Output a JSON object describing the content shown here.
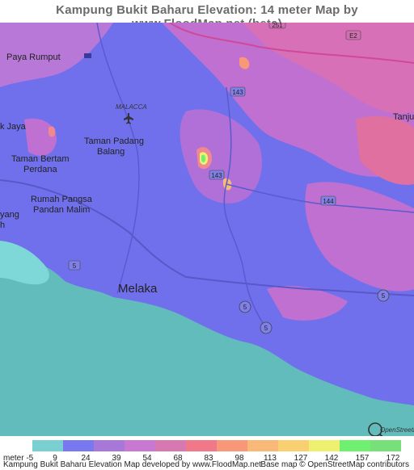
{
  "title": "Kampung Bukit Baharu Elevation: 14 meter Map by www.FloodMap.net (beta)",
  "map": {
    "places": [
      {
        "name": "Paya Rumput"
      },
      {
        "name": "MALACCA"
      },
      {
        "name": "Tanjung"
      },
      {
        "name": "k Jaya"
      },
      {
        "name": "Taman Padang"
      },
      {
        "name": "Balang"
      },
      {
        "name": "Taman Bertam"
      },
      {
        "name": "Perdana"
      },
      {
        "name": "Rumah Pangsa"
      },
      {
        "name": "Pandan Malim"
      },
      {
        "name": "yang"
      },
      {
        "name": "h"
      },
      {
        "name": "Melaka"
      }
    ],
    "road_shields": [
      "E2",
      "143",
      "143",
      "144",
      "5",
      "5",
      "5",
      "5",
      "251"
    ],
    "watermark": "OpenStreetMap"
  },
  "legend": {
    "unit_label": "meter",
    "ticks": [
      "-5",
      "9",
      "24",
      "39",
      "54",
      "68",
      "83",
      "98",
      "113",
      "127",
      "142",
      "157",
      "172"
    ],
    "colors": [
      "#7ad0d0",
      "#7878f0",
      "#a878d8",
      "#c878d0",
      "#d878b0",
      "#f07888",
      "#f89878",
      "#f8b878",
      "#f8d070",
      "#f0f070",
      "#70f070",
      "#78e078"
    ]
  },
  "footer": {
    "left": "Kampung Bukit Baharu Elevation Map developed by www.FloodMap.net",
    "right": "Base map © OpenStreetMap contributors"
  }
}
